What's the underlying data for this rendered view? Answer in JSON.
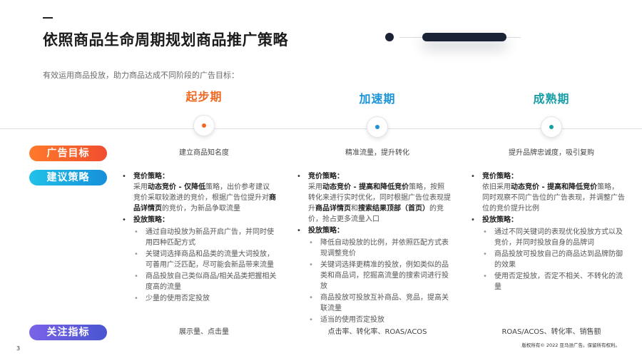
{
  "title": "依照商品生命周期规划商品推广策略",
  "subtitle": "有效运用商品投放，助力商品达成不同阶段的广告目标：",
  "stages": [
    {
      "name": "起步期",
      "color": "#ee6a22"
    },
    {
      "name": "加速期",
      "color": "#1a93d8"
    },
    {
      "name": "成熟期",
      "color": "#179da8"
    }
  ],
  "rows": {
    "goal_label": "广告目标",
    "strategy_label": "建议策略",
    "metrics_label": "关注指标"
  },
  "goals": [
    "建立商品知名度",
    "精准流量，提升转化",
    "提升品牌忠诚度，吸引复购"
  ],
  "metrics": [
    "展示量、点击量",
    "点击率、转化率、ROAS/ACOS",
    "ROAS/ACOS、转化率、销售额"
  ],
  "strategy": {
    "bidding_heading": "竞价策略：",
    "placement_heading": "投放策略：",
    "col1": {
      "bid_pre": "采用",
      "bid_strong1": "动态竞价 - 仅降低",
      "bid_mid": "策略，出价参考建议竞价采取较激进的竞价，根据广告位提升对",
      "bid_strong2": "商品详情页",
      "bid_post": "的竞价，为新品争取流量",
      "items": [
        "通过自动投放为新品开启广告，并同时使用四种匹配方式",
        "关键词选择商品和品类的流量大词投放，可善用广泛匹配，尽可能会新品带来流量",
        "商品投放自己类似商品/相关品类把握相关度高的流量",
        "少量的使用否定投放"
      ]
    },
    "col2": {
      "bid_pre": "采用",
      "bid_strong1": "动态竞价 - 提高和降低竞价",
      "bid_mid": "策略，按照转化来进行实时优化，同时根据广告位表现提升",
      "bid_strong2": "商品详情页",
      "bid_and": "和",
      "bid_strong3": "搜索结果顶部（首页）",
      "bid_post": "的竞价，抢占更多流量入口",
      "items": [
        "降低自动投放的比例，并依照匹配方式表现调整竞价",
        "关键词选择更精准的投放，例如类似的品类和商品词，挖掘高流量的搜索词进行投放",
        "商品投放可投放互补商品、竞品，提高关联流量",
        "适当的使用否定投放"
      ]
    },
    "col3": {
      "bid_pre": "依旧采用",
      "bid_strong1": "动态竞价 - 提高和降低竞价",
      "bid_post": "策略，同时观察不同广告位的广告表现，并调整广告位的竞价提升比例",
      "items": [
        "通过不同关键词的表现优化投放方式以及竞价，并同时投放自身的品牌词",
        "商品投放可投放自己的商品达到品牌防御的效果",
        "使用否定投放，否定不相关、不转化的流量"
      ]
    }
  },
  "page_number": "3",
  "copyright": "版权所有© 2022 亚马逊广告。保留所有权利。"
}
